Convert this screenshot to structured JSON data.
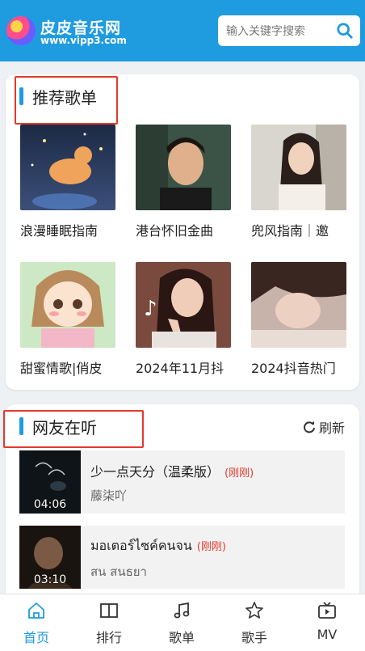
{
  "header": {
    "logo_title": "皮皮音乐网",
    "logo_subtitle": "www.vipp3.com",
    "search_placeholder": "输入关键字搜索",
    "brand_color": "#1f9be0"
  },
  "recommended": {
    "title": "推荐歌单",
    "playlists": [
      {
        "label": "浪漫睡眠指南"
      },
      {
        "label": "港台怀旧金曲"
      },
      {
        "label": "兜风指南｜邀"
      },
      {
        "label": "甜蜜情歌|俏皮"
      },
      {
        "label": "2024年11月抖"
      },
      {
        "label": "2024抖音热门"
      }
    ]
  },
  "listening": {
    "title": "网友在听",
    "refresh_label": "刷新",
    "songs": [
      {
        "title": "少一点天分（温柔版）",
        "tag": "(刚刚)",
        "artist": "藤柒吖",
        "duration": "04:06"
      },
      {
        "title": "มอเตอร์ไซค์คนจน",
        "tag": "(刚刚)",
        "artist": "สน สนธยา",
        "duration": "03:10"
      }
    ]
  },
  "nav": {
    "items": [
      {
        "label": "首页",
        "icon": "home-icon",
        "active": true
      },
      {
        "label": "排行",
        "icon": "book-icon"
      },
      {
        "label": "歌单",
        "icon": "music-note-icon"
      },
      {
        "label": "歌手",
        "icon": "star-icon"
      },
      {
        "label": "MV",
        "icon": "tv-icon"
      }
    ]
  },
  "accent_red": "#e5392b"
}
